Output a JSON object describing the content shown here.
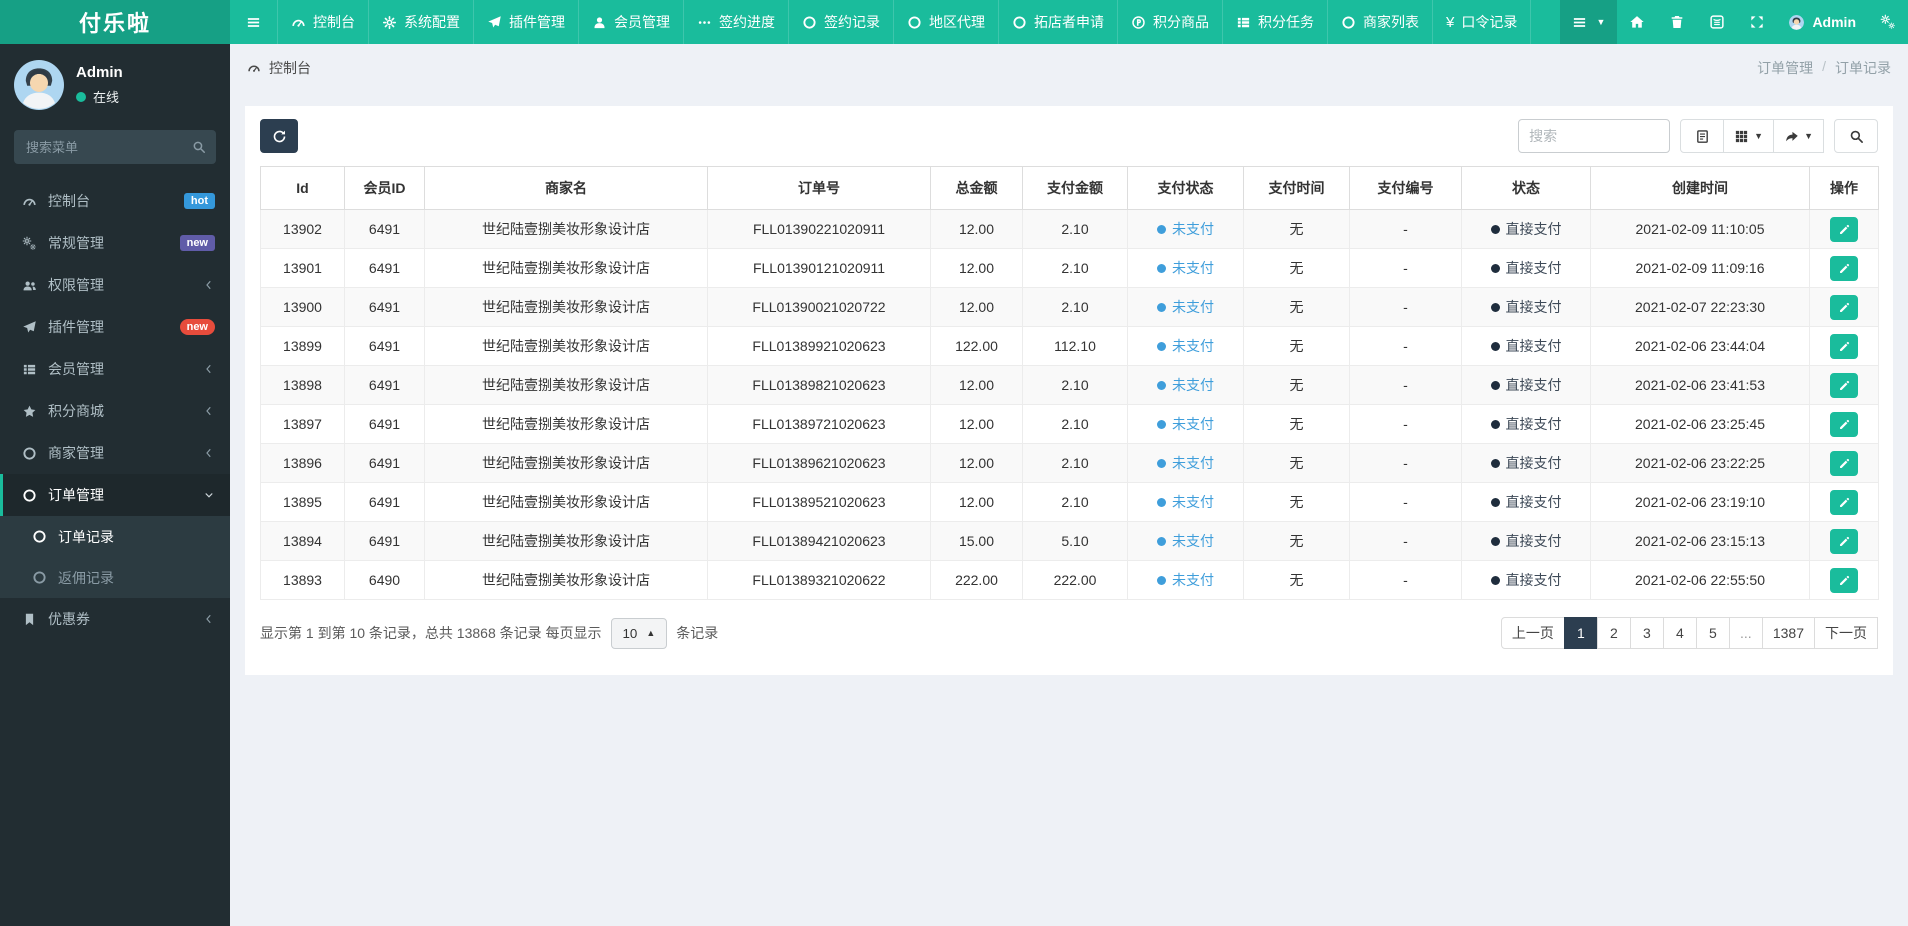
{
  "colors": {
    "accent": "#1abc9c",
    "brand_bg": "#16a085",
    "sidebar_bg": "#222d32",
    "sidebar_active_bg": "#1e282c",
    "submenu_bg": "#2c3b41",
    "dark": "#2c3e50",
    "link_blue": "#3f9edb",
    "content_bg": "#eef1f6",
    "stripe": "#f9f9f9",
    "badge_blue": "#3498db",
    "badge_purple": "#605ca8",
    "badge_red": "#e74c3c"
  },
  "brand": "付乐啦",
  "navbar": {
    "toggle_icon": "bars",
    "menu": [
      {
        "icon": "tachometer",
        "label": "控制台"
      },
      {
        "icon": "cog",
        "label": "系统配置"
      },
      {
        "icon": "send",
        "label": "插件管理"
      },
      {
        "icon": "user",
        "label": "会员管理"
      },
      {
        "icon": "ellipsis",
        "label": "签约进度"
      },
      {
        "icon": "circle-o",
        "label": "签约记录"
      },
      {
        "icon": "circle-o",
        "label": "地区代理"
      },
      {
        "icon": "circle-o",
        "label": "拓店者申请"
      },
      {
        "icon": "product",
        "label": "积分商品"
      },
      {
        "icon": "th-list",
        "label": "积分任务"
      },
      {
        "icon": "circle-o",
        "label": "商家列表"
      },
      {
        "icon": "yen",
        "label": "口令记录"
      }
    ],
    "right": {
      "dropdown": {
        "icon": "bars",
        "caret": "caret-down"
      },
      "quick_items": [
        {
          "icon": "home"
        },
        {
          "icon": "trash"
        },
        {
          "icon": "app"
        },
        {
          "icon": "expand"
        }
      ],
      "user": {
        "avatar_icon": "avatar",
        "name": "Admin"
      },
      "settings_icon": "cogs"
    }
  },
  "sidebar": {
    "user": {
      "avatar_icon": "avatar",
      "name": "Admin",
      "status": "在线"
    },
    "search_placeholder": "搜索菜单",
    "search_icon": "search",
    "items": [
      {
        "icon": "tachometer",
        "label": "控制台",
        "badge": "hot",
        "badge_cls": "b-blue"
      },
      {
        "icon": "cogs",
        "label": "常规管理",
        "badge": "new",
        "badge_cls": "b-purple"
      },
      {
        "icon": "users",
        "label": "权限管理",
        "arrow": "angle-left"
      },
      {
        "icon": "send",
        "label": "插件管理",
        "badge": "new",
        "badge_cls": "b-red"
      },
      {
        "icon": "th-list",
        "label": "会员管理",
        "arrow": "angle-left"
      },
      {
        "icon": "star",
        "label": "积分商城",
        "arrow": "angle-left"
      },
      {
        "icon": "circle-o",
        "label": "商家管理",
        "arrow": "angle-left"
      },
      {
        "icon": "circle-o",
        "label": "订单管理",
        "arrow": "angle-down",
        "cls": "active"
      },
      {
        "icon": "circle-o",
        "label": "订单记录",
        "cls": "sub on"
      },
      {
        "icon": "circle-o",
        "label": "返佣记录",
        "cls": "sub"
      },
      {
        "icon": "bookmark",
        "label": "优惠券",
        "arrow": "angle-left"
      }
    ]
  },
  "breadcrumb": {
    "icon": "tachometer",
    "title": "控制台",
    "trail": [
      "订单管理",
      "订单记录"
    ],
    "separator": "/"
  },
  "toolbar": {
    "refresh_icon": "refresh",
    "search_placeholder": "搜索",
    "view_buttons": [
      {
        "icon": "page"
      },
      {
        "icon": "grid",
        "caret": "caret-down"
      },
      {
        "icon": "export",
        "caret": "caret-down"
      }
    ],
    "search_icon": "search"
  },
  "table": {
    "columns": [
      "Id",
      "会员ID",
      "商家名",
      "订单号",
      "总金额",
      "支付金额",
      "支付状态",
      "支付时间",
      "支付编号",
      "状态",
      "创建时间",
      "操作"
    ],
    "action_icon": "pencil",
    "rows": [
      {
        "id": "13902",
        "member_id": "6491",
        "merchant": "世纪陆壹捌美妆形象设计店",
        "order_no": "FLL01390221020911",
        "total": "12.00",
        "paid": "2.10",
        "pay_status": "未支付",
        "pay_time": "无",
        "pay_no": "-",
        "status": "直接支付",
        "created": "2021-02-09 11:10:05"
      },
      {
        "id": "13901",
        "member_id": "6491",
        "merchant": "世纪陆壹捌美妆形象设计店",
        "order_no": "FLL01390121020911",
        "total": "12.00",
        "paid": "2.10",
        "pay_status": "未支付",
        "pay_time": "无",
        "pay_no": "-",
        "status": "直接支付",
        "created": "2021-02-09 11:09:16"
      },
      {
        "id": "13900",
        "member_id": "6491",
        "merchant": "世纪陆壹捌美妆形象设计店",
        "order_no": "FLL01390021020722",
        "total": "12.00",
        "paid": "2.10",
        "pay_status": "未支付",
        "pay_time": "无",
        "pay_no": "-",
        "status": "直接支付",
        "created": "2021-02-07 22:23:30"
      },
      {
        "id": "13899",
        "member_id": "6491",
        "merchant": "世纪陆壹捌美妆形象设计店",
        "order_no": "FLL01389921020623",
        "total": "122.00",
        "paid": "112.10",
        "pay_status": "未支付",
        "pay_time": "无",
        "pay_no": "-",
        "status": "直接支付",
        "created": "2021-02-06 23:44:04"
      },
      {
        "id": "13898",
        "member_id": "6491",
        "merchant": "世纪陆壹捌美妆形象设计店",
        "order_no": "FLL01389821020623",
        "total": "12.00",
        "paid": "2.10",
        "pay_status": "未支付",
        "pay_time": "无",
        "pay_no": "-",
        "status": "直接支付",
        "created": "2021-02-06 23:41:53"
      },
      {
        "id": "13897",
        "member_id": "6491",
        "merchant": "世纪陆壹捌美妆形象设计店",
        "order_no": "FLL01389721020623",
        "total": "12.00",
        "paid": "2.10",
        "pay_status": "未支付",
        "pay_time": "无",
        "pay_no": "-",
        "status": "直接支付",
        "created": "2021-02-06 23:25:45"
      },
      {
        "id": "13896",
        "member_id": "6491",
        "merchant": "世纪陆壹捌美妆形象设计店",
        "order_no": "FLL01389621020623",
        "total": "12.00",
        "paid": "2.10",
        "pay_status": "未支付",
        "pay_time": "无",
        "pay_no": "-",
        "status": "直接支付",
        "created": "2021-02-06 23:22:25"
      },
      {
        "id": "13895",
        "member_id": "6491",
        "merchant": "世纪陆壹捌美妆形象设计店",
        "order_no": "FLL01389521020623",
        "total": "12.00",
        "paid": "2.10",
        "pay_status": "未支付",
        "pay_time": "无",
        "pay_no": "-",
        "status": "直接支付",
        "created": "2021-02-06 23:19:10"
      },
      {
        "id": "13894",
        "member_id": "6491",
        "merchant": "世纪陆壹捌美妆形象设计店",
        "order_no": "FLL01389421020623",
        "total": "15.00",
        "paid": "5.10",
        "pay_status": "未支付",
        "pay_time": "无",
        "pay_no": "-",
        "status": "直接支付",
        "created": "2021-02-06 23:15:13"
      },
      {
        "id": "13893",
        "member_id": "6490",
        "merchant": "世纪陆壹捌美妆形象设计店",
        "order_no": "FLL01389321020622",
        "total": "222.00",
        "paid": "222.00",
        "pay_status": "未支付",
        "pay_time": "无",
        "pay_no": "-",
        "status": "直接支付",
        "created": "2021-02-06 22:55:50"
      }
    ]
  },
  "footer": {
    "summary_prefix": "显示第 1 到第 10 条记录，总共 13868 条记录 每页显示",
    "page_size": "10",
    "page_size_caret": "caret-up",
    "summary_suffix": "条记录",
    "pagination": [
      {
        "label": "上一页"
      },
      {
        "label": "1",
        "cls": "active"
      },
      {
        "label": "2"
      },
      {
        "label": "3"
      },
      {
        "label": "4"
      },
      {
        "label": "5"
      },
      {
        "label": "...",
        "cls": "disabled"
      },
      {
        "label": "1387"
      },
      {
        "label": "下一页"
      }
    ]
  }
}
